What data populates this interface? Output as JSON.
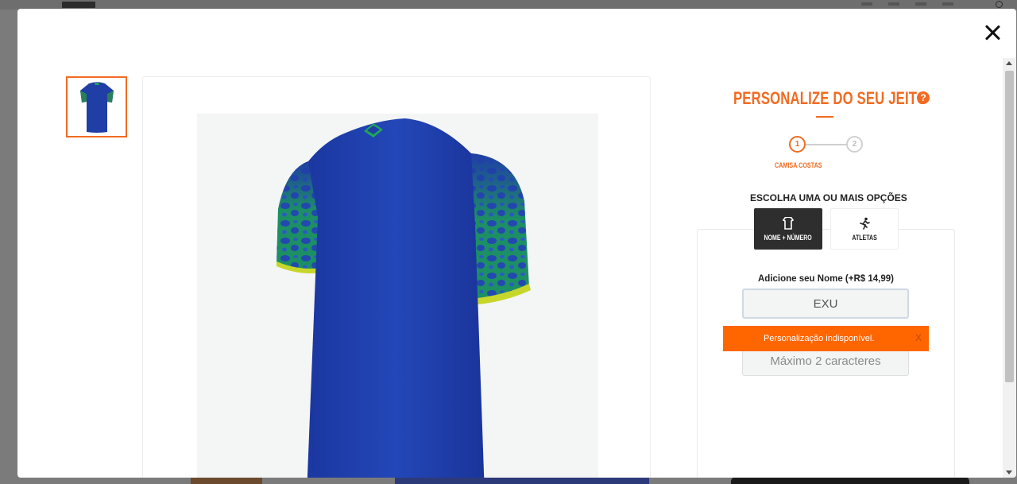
{
  "modal": {
    "close_label": "Close",
    "thumbnail_alt": "Camisa costas"
  },
  "customizer": {
    "title": "PERSONALIZE DO SEU JEITO",
    "help_label": "?",
    "steps": [
      {
        "number": "1",
        "label": "CAMISA COSTAS",
        "active": true
      },
      {
        "number": "2",
        "label": "",
        "active": false
      }
    ],
    "choose_label": "ESCOLHA UMA OU MAIS OPÇÕES",
    "options": [
      {
        "label": "NOME + NÚMERO",
        "icon": "jersey-icon",
        "selected": true
      },
      {
        "label": "ATLETAS",
        "icon": "runner-icon",
        "selected": false
      }
    ],
    "name_field": {
      "label": "Adicione seu Nome (+R$ 14,99)",
      "value": "EXU"
    },
    "number_field": {
      "placeholder": "Máximo 2 caracteres"
    },
    "toast": {
      "message": "Personalização indisponível.",
      "close_label": "X"
    }
  },
  "colors": {
    "accent": "#f26b21",
    "toast_bg": "#ff6600",
    "jersey_blue": "#1f3ea6",
    "jersey_green": "#1fa55b"
  }
}
